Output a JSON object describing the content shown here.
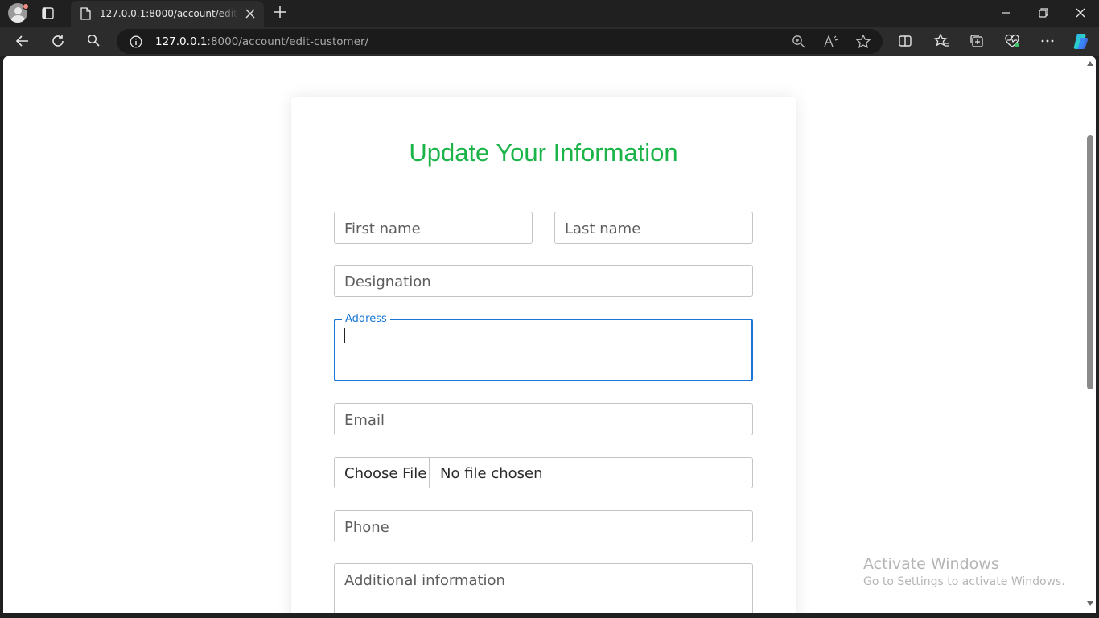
{
  "browser": {
    "tab": {
      "title": "127.0.0.1:8000/account/edit-customer/"
    },
    "address": {
      "host": "127.0.0.1",
      "path": ":8000/account/edit-customer/"
    }
  },
  "form": {
    "title": "Update Your Information",
    "title_color": "#1bb449",
    "focus_color": "#1976d2",
    "first_name_placeholder": "First name",
    "last_name_placeholder": "Last name",
    "designation_placeholder": "Designation",
    "address_label": "Address",
    "address_value": "",
    "email_placeholder": "Email",
    "file_button_label": "Choose File",
    "file_status": "No file chosen",
    "phone_placeholder": "Phone",
    "additional_info_placeholder": "Additional information"
  },
  "watermark": {
    "line1": "Activate Windows",
    "line2": "Go to Settings to activate Windows."
  },
  "icons": [
    "profile-icon",
    "tab-actions-icon",
    "page-icon",
    "close-icon",
    "plus-icon",
    "minimize-icon",
    "restore-icon",
    "back-icon",
    "refresh-icon",
    "search-icon",
    "info-icon",
    "zoom-icon",
    "read-aloud-icon",
    "star-icon",
    "split-screen-icon",
    "favorites-icon",
    "collections-icon",
    "performance-icon",
    "more-icon",
    "copilot-icon"
  ]
}
